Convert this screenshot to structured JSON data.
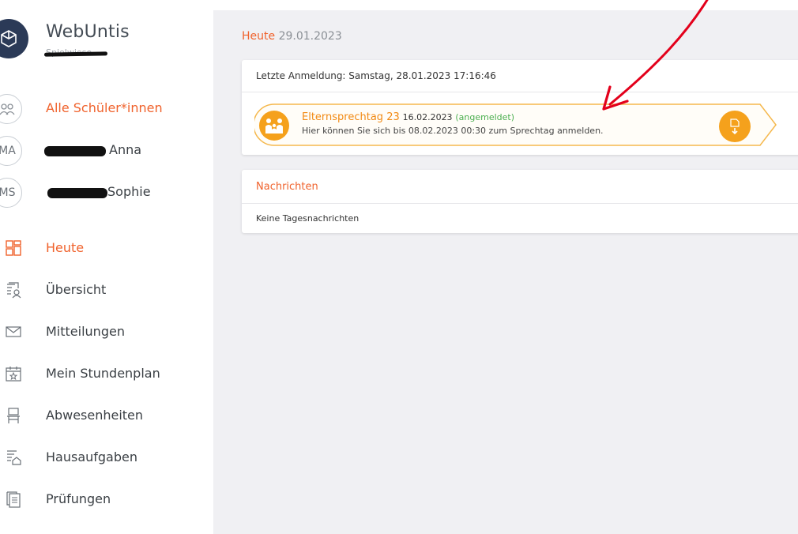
{
  "app": {
    "title": "WebUntis",
    "school": "Spielwiese"
  },
  "students": [
    {
      "initials": "",
      "label": "Alle Schüler*innen",
      "active": true
    },
    {
      "initials": "MA",
      "label": "Anna"
    },
    {
      "initials": "MS",
      "label": "Sophie"
    }
  ],
  "nav": [
    {
      "label": "Heute",
      "icon": "dashboard-icon",
      "active": true
    },
    {
      "label": "Übersicht",
      "icon": "overview-icon"
    },
    {
      "label": "Mitteilungen",
      "icon": "mail-icon"
    },
    {
      "label": "Mein Stundenplan",
      "icon": "timetable-icon"
    },
    {
      "label": "Abwesenheiten",
      "icon": "absence-icon"
    },
    {
      "label": "Hausaufgaben",
      "icon": "homework-icon"
    },
    {
      "label": "Prüfungen",
      "icon": "exams-icon"
    }
  ],
  "today": {
    "heading": "Heute",
    "date": "29.01.2023",
    "last_login": "Letzte Anmeldung: Samstag, 28.01.2023 17:16:46",
    "event": {
      "name": "Elternsprechtag 23",
      "date": "16.02.2023",
      "status": "(angemeldet)",
      "description": "Hier können Sie sich bis 08.02.2023 00:30 zum Sprechtag anmelden."
    }
  },
  "messages": {
    "title": "Nachrichten",
    "empty": "Keine Tagesnachrichten"
  },
  "colors": {
    "accent": "#f0622c",
    "event_orange": "#f5a11c",
    "registered_green": "#4caf50",
    "logo_navy": "#2b3a57",
    "annotation_red": "#e3001b"
  }
}
